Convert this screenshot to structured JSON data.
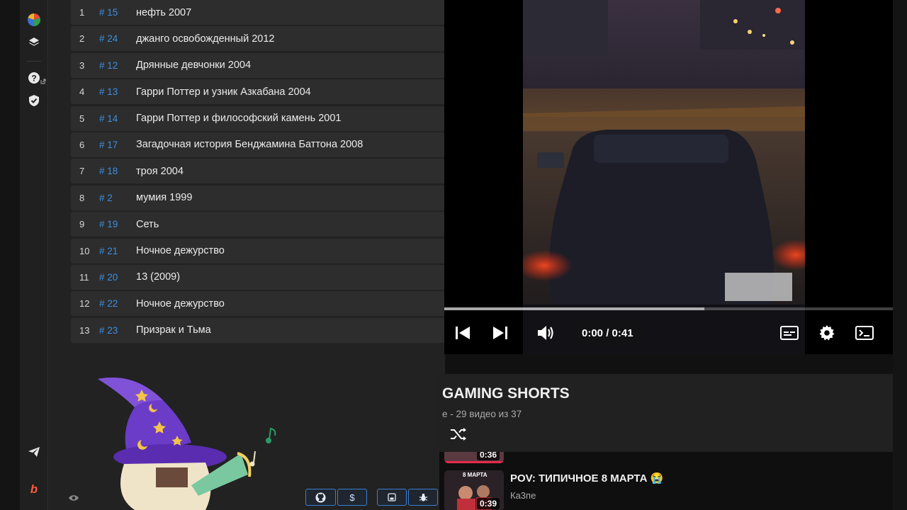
{
  "list": [
    {
      "n": "1",
      "id": "# 15",
      "title": "нефть 2007"
    },
    {
      "n": "2",
      "id": "# 24",
      "title": "джанго освобожденный 2012"
    },
    {
      "n": "3",
      "id": "# 12",
      "title": "Дрянные девчонки 2004"
    },
    {
      "n": "4",
      "id": "# 13",
      "title": "Гарри Поттер и узник Азкабана 2004"
    },
    {
      "n": "5",
      "id": "# 14",
      "title": "Гарри Поттер и философский камень 2001"
    },
    {
      "n": "6",
      "id": "# 17",
      "title": "Загадочная история Бенджамина Баттона 2008"
    },
    {
      "n": "7",
      "id": "# 18",
      "title": "троя 2004"
    },
    {
      "n": "8",
      "id": "# 2",
      "title": "мумия 1999"
    },
    {
      "n": "9",
      "id": "# 19",
      "title": "Сеть"
    },
    {
      "n": "10",
      "id": "# 21",
      "title": "Ночное дежурство"
    },
    {
      "n": "11",
      "id": "# 20",
      "title": "13 (2009)"
    },
    {
      "n": "12",
      "id": "# 22",
      "title": "Ночное дежурство"
    },
    {
      "n": "13",
      "id": "# 23",
      "title": "Призрак и Тьма"
    }
  ],
  "bottom_buttons": {
    "dollar": "$"
  },
  "player": {
    "time": "0:00 / 0:41",
    "progress": 0.58
  },
  "playlist": {
    "title": "GAMING SHORTS",
    "subtitle": "e - 29 видео из 37",
    "items": [
      {
        "duration": "0:36"
      },
      {
        "duration": "0:39",
        "title": "POV: ТИПИЧНОЕ 8 МАРТА 😭",
        "channel": "Ка3пе",
        "thumb_text": "8 МАРТА"
      }
    ]
  },
  "icons": {
    "rail": [
      "pie-chart-icon",
      "layers-icon",
      "help-icon",
      "shield-icon",
      "send-icon",
      "brand-b-icon"
    ],
    "accent": "#3b8fe0"
  }
}
